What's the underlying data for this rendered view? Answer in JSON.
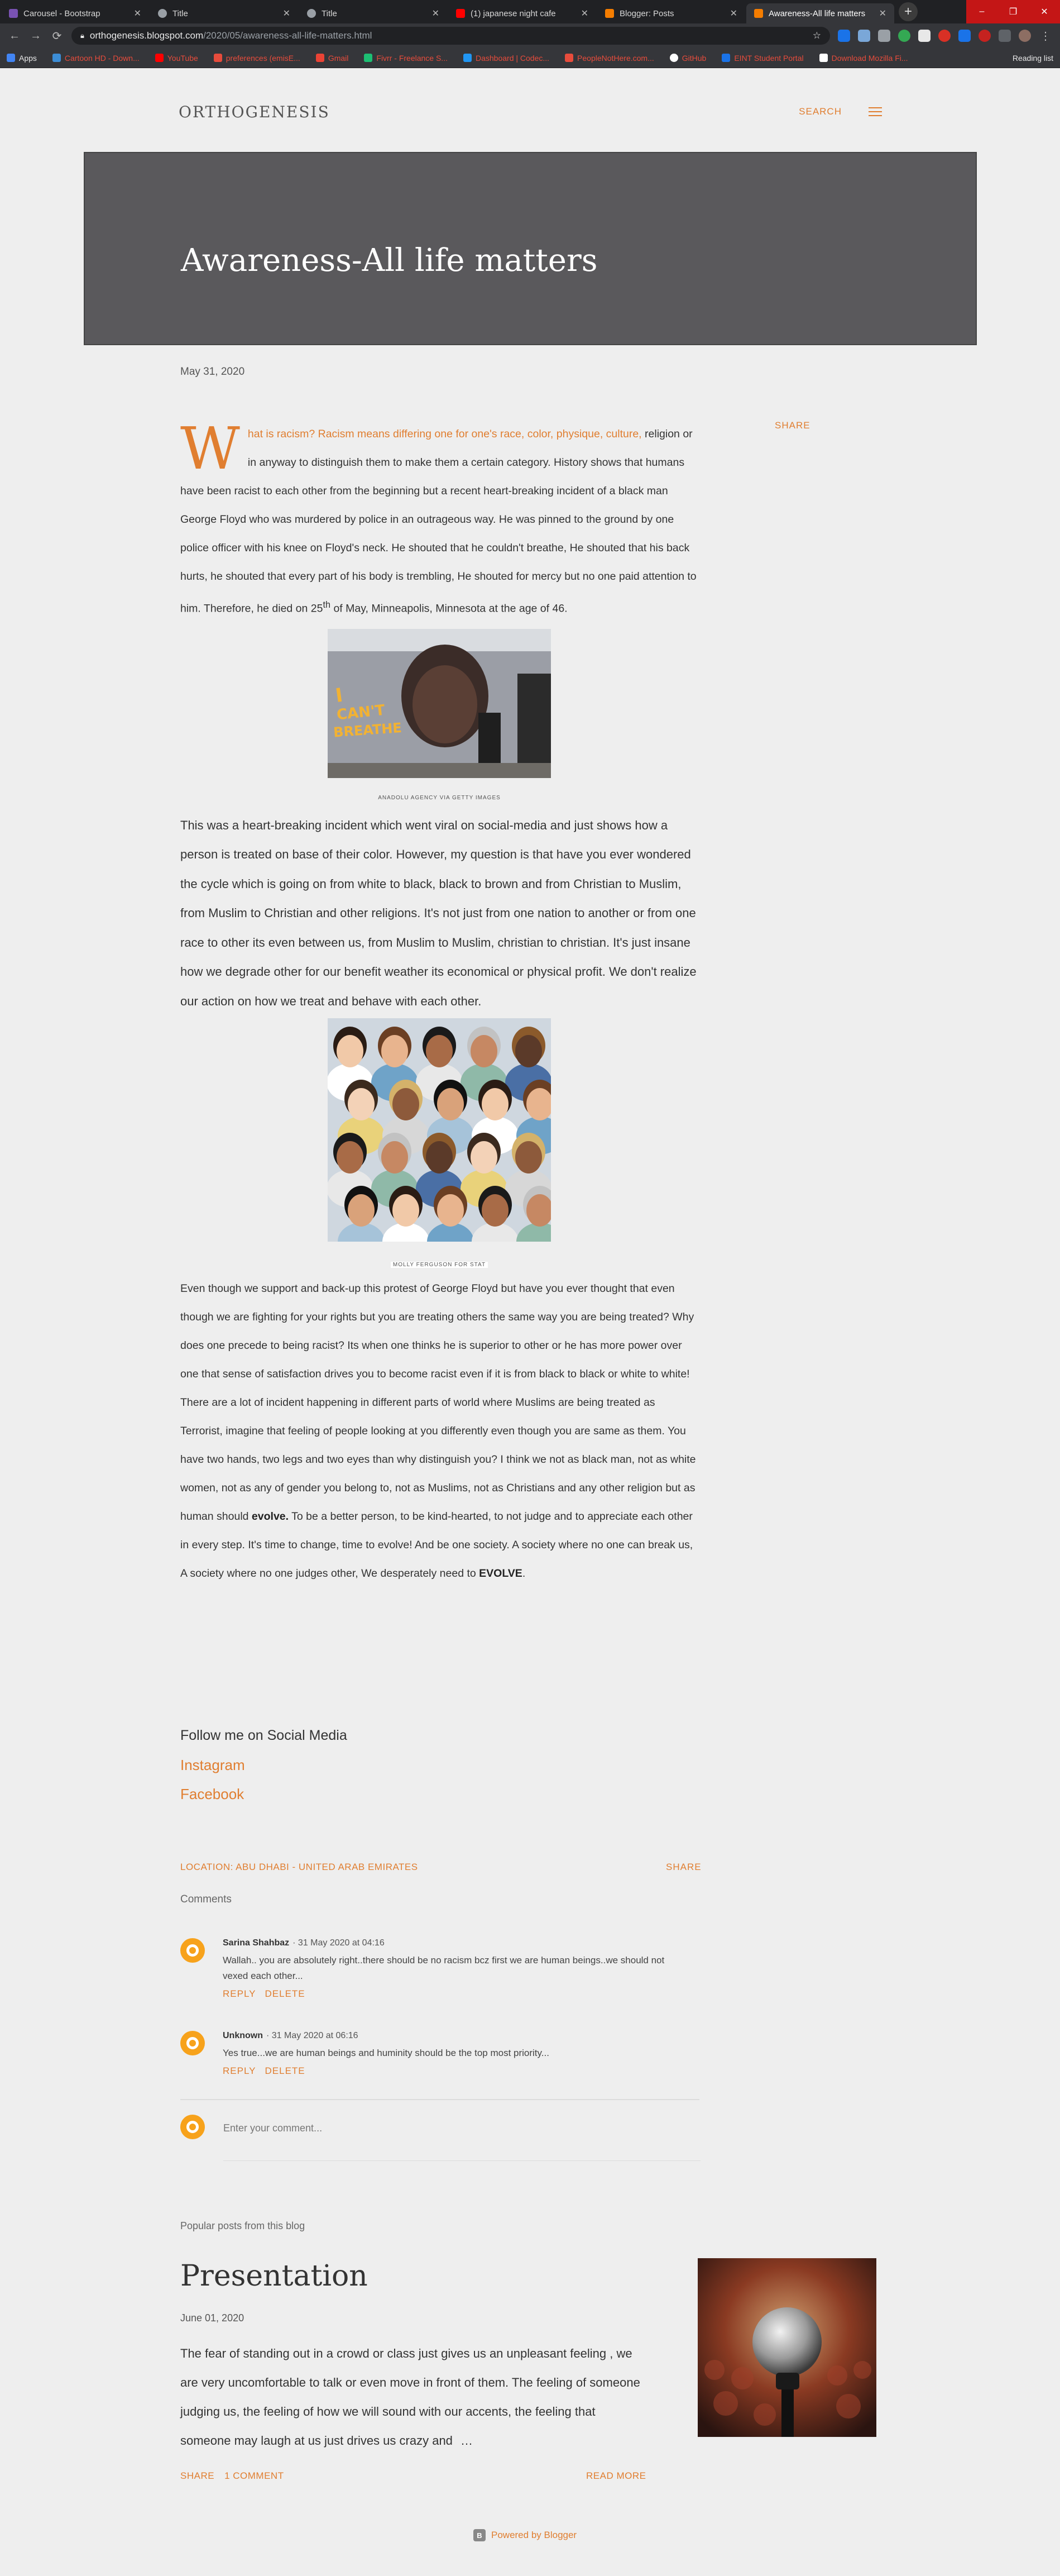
{
  "browser": {
    "tabs": [
      {
        "label": "Carousel - Bootstrap",
        "icon": "bootstrap-icon",
        "color": "#7952b3"
      },
      {
        "label": "Title",
        "icon": "globe-icon",
        "color": "#9aa0a6"
      },
      {
        "label": "Title",
        "icon": "globe-icon",
        "color": "#9aa0a6"
      },
      {
        "label": "(1) japanese night cafe",
        "icon": "youtube-icon",
        "color": "#ff0000"
      },
      {
        "label": "Blogger: Posts",
        "icon": "blogger-icon",
        "color": "#f57d00"
      },
      {
        "label": "Awareness-All life matters",
        "icon": "blogger-icon",
        "color": "#f57d00"
      }
    ],
    "new_tab": "+",
    "window_controls": [
      "–",
      "❐",
      "✕"
    ],
    "url_domain": "orthogenesis.blogspot.com",
    "url_path": "/2020/05/awareness-all-life-matters.html",
    "bookmarks": [
      {
        "label": "Apps",
        "color": "#4285f4"
      },
      {
        "label": "Cartoon HD - Down...",
        "color": "#3c8dd6"
      },
      {
        "label": "YouTube",
        "color": "#ff0000"
      },
      {
        "label": "preferences (emisE...",
        "color": "#e74c3c"
      },
      {
        "label": "Gmail",
        "color": "#ea4335"
      },
      {
        "label": "Fivrr - Freelance S...",
        "color": "#1dbf73"
      },
      {
        "label": "Dashboard | Codec...",
        "color": "#2196f3"
      },
      {
        "label": "PeopleNotHere.com...",
        "color": "#e74c3c"
      },
      {
        "label": "GitHub",
        "color": "#ffffff"
      },
      {
        "label": "EINT Student Portal",
        "color": "#1a73e8"
      },
      {
        "label": "Download Mozilla Fi...",
        "color": "#ffffff"
      }
    ],
    "reading_list": "Reading list"
  },
  "blog": {
    "title": "ORTHOGENESIS",
    "search": "SEARCH",
    "accent": "#e07e30"
  },
  "post": {
    "title": "Awareness-All life matters",
    "date": "May 31, 2020",
    "share": "SHARE",
    "dropcap": "W",
    "intro_highlight": "hat is racism? Racism means differing one for one's race, color, physique, culture,",
    "p1_rest": " religion or in anyway to distinguish them to make them a certain category. History shows that humans have been racist to each other from the beginning but a recent heart-breaking incident of a black man George Floyd who was murdered by police in an outrageous way. He was pinned to the ground by one police officer with his knee on Floyd's neck. He shouted that he couldn't breathe, He shouted that his back hurts, he shouted that every part of his body is trembling, He shouted for mercy but no one paid attention to him. Therefore, he died on 25",
    "p1_sup": "th",
    "p1_end": " of May, Minneapolis, Minnesota at the age of 46.",
    "image1_text": "I CAN'T BREATHE",
    "image1_caption": "ANADOLU AGENCY VIA GETTY IMAGES",
    "p2": "This was a heart-breaking incident which went viral on social-media and just shows how a person is treated on base of their color. However, my question is that have you ever wondered the cycle which is going on from white to black, black to brown and from Christian to Muslim, from Muslim to Christian and other religions. It's not just from one nation to another or from one race to other its even between us, from Muslim to Muslim, christian to christian. It's just insane how we degrade other for our benefit weather its economical or physical profit. We don't realize our action on how we treat and behave with each other.",
    "image2_caption": "MOLLY FERGUSON FOR STAT",
    "p3_a": "Even though we support and back-up this protest of George Floyd but have you ever thought that even though we are fighting for your rights but you are treating others the same way you are being treated? Why does one precede to being racist? Its when one thinks he is superior to other or he has more power over one that sense of satisfaction drives you to become racist even if it is from black to black or white to white! There are a lot of incident happening in different parts of world where Muslims are being treated as Terrorist, imagine that feeling of people looking at you differently even though you are same as them. You have two hands, two legs and two eyes than why distinguish you? I think we not as black man, not as white women, not as any of gender you belong to, not as Muslims, not as Christians and any other religion but as human should ",
    "p3_bold1": "evolve.",
    "p3_b": " To be a better person, to be kind-hearted, to not judge and to appreciate each other in every step. It's time to change, time to evolve! And be one society. A society where no one can break us, A society where no one judges other, We desperately need to ",
    "p3_bold2": "EVOLVE",
    "p3_end": ".",
    "follow": "Follow me on Social Media",
    "instagram": "Instagram",
    "facebook": "Facebook",
    "location": "LOCATION: ABU DHABI - UNITED ARAB EMIRATES",
    "share_bottom": "SHARE"
  },
  "comments": {
    "heading": "Comments",
    "items": [
      {
        "author": "Sarina Shahbaz",
        "time": "· 31 May 2020 at 04:16",
        "text": "Wallah.. you are absolutely right..there should be no racism bcz first we are human beings..we should not vexed each other...",
        "reply": "REPLY",
        "delete": "DELETE"
      },
      {
        "author": "Unknown",
        "time": "· 31 May 2020 at 06:16",
        "text": "Yes true...we are human beings and huminity should be the top most priority...",
        "reply": "REPLY",
        "delete": "DELETE"
      }
    ],
    "input_placeholder": "Enter your comment..."
  },
  "popular": {
    "heading": "Popular posts from this blog",
    "title": "Presentation",
    "date": "June 01, 2020",
    "text": "The fear of standing out in a crowd or class just gives us an unpleasant feeling , we are very uncomfortable to talk or even move in front of them. The feeling of someone judging us, the feeling of how we will sound with our accents, the feeling that someone may laugh at us just drives us crazy and",
    "ellipsis": "…",
    "share": "SHARE",
    "comments": "1 COMMENT",
    "read_more": "READ MORE"
  },
  "footer": {
    "powered": "Powered by Blogger"
  }
}
